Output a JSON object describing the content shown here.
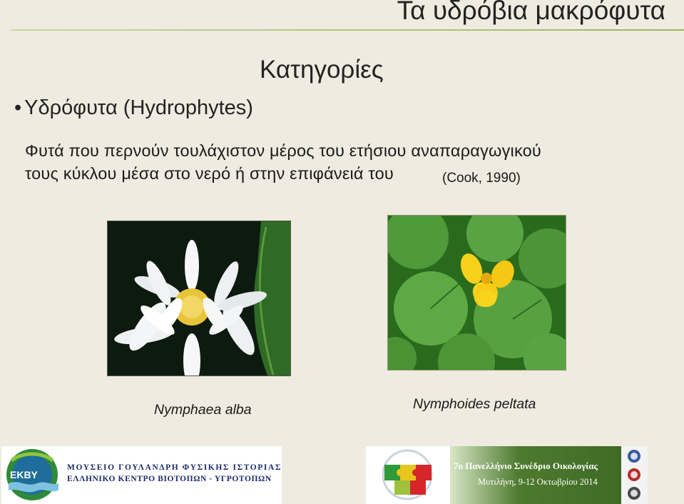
{
  "slide": {
    "title": "Τα υδρόβια μακρόφυτα",
    "subtitle": "Κατηγορίες",
    "bullet_marker": "•",
    "bullet": "Υδρόφυτα (Hydrophytes)",
    "definition_line1": "Φυτά που περνούν τουλάχιστον μέρος του ετήσιου αναπαραγωγικού",
    "definition_line2": "τους κύκλου μέσα στο νερό ή στην επιφάνειά του",
    "citation": "(Cook, 1990)"
  },
  "photos": {
    "left_caption": "Nymphaea alba",
    "right_caption": "Nymphoides peltata"
  },
  "footer": {
    "ekby_logo_text": "EKBY",
    "museum_line1": "ΜΟΥΣΕΙΟ ΓΟΥΛΑΝΔΡΗ ΦΥΣΙΚΗΣ ΙΣΤΟΡΙΑΣ",
    "museum_line2": "ΕΛΛΗΝΙΚΟ ΚΕΝΤΡΟ ΒΙΟΤΟΠΩΝ - ΥΓΡΟΤΟΠΩΝ",
    "conference_line1": "7ο Πανελλήνιο Συνέδριο Οικολογίας",
    "conference_line2": "Μυτιλήνη, 9-12 Οκτωβρίου 2014"
  },
  "colors": {
    "background": "#efebe0",
    "title_rule": "#9bb55a",
    "museum_text": "#1c2a6a",
    "conference_strip": "#4e7a2e"
  }
}
